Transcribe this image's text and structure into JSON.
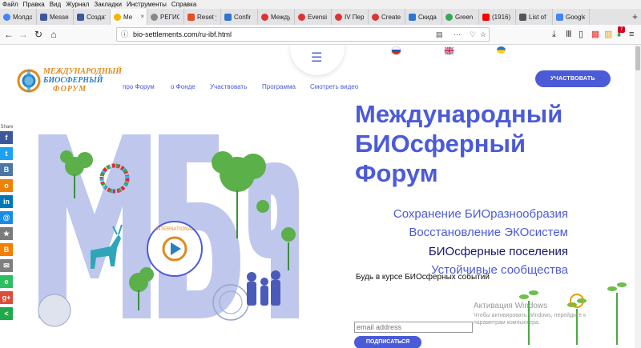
{
  "menu": [
    "Файл",
    "Правка",
    "Вид",
    "Журнал",
    "Закладки",
    "Инструменты",
    "Справка"
  ],
  "tabs": [
    {
      "label": "Молдо",
      "color": "#4285f4",
      "round": true
    },
    {
      "label": "Messen",
      "color": "#3b5998",
      "round": false
    },
    {
      "label": "Создат",
      "color": "#3b5998",
      "round": false
    },
    {
      "label": "Ме",
      "color": "#f4b400",
      "round": true,
      "active": true
    },
    {
      "label": "РЕГИС",
      "color": "#888888",
      "round": true
    },
    {
      "label": "Reset y",
      "color": "#e34f26",
      "round": false
    },
    {
      "label": "Confir",
      "color": "#2d78cd",
      "round": false
    },
    {
      "label": "Между",
      "color": "#d33",
      "round": true
    },
    {
      "label": "Evensi",
      "color": "#d33",
      "round": true
    },
    {
      "label": "IV Пер",
      "color": "#d33",
      "round": true
    },
    {
      "label": "Create",
      "color": "#d33",
      "round": true
    },
    {
      "label": "Скида",
      "color": "#2d78cd",
      "round": false
    },
    {
      "label": "Green C",
      "color": "#34a853",
      "round": true
    },
    {
      "label": "(1916)",
      "color": "#ff0000",
      "round": false
    },
    {
      "label": "List of f",
      "color": "#555555",
      "round": false
    },
    {
      "label": "Google",
      "color": "#4285f4",
      "round": false
    }
  ],
  "address": {
    "url": "bio-settlements.com/ru-ibf.html"
  },
  "toolbar": {
    "downloads_badge": "7"
  },
  "logo": {
    "line1": "МЕЖДУНАРОДНЫЙ",
    "line2": "БИОСФЕРНЫЙ",
    "line3": "ФОРУМ"
  },
  "nav": [
    {
      "label": "про Форум"
    },
    {
      "label": "о Фонде"
    },
    {
      "label": "Участвовать"
    },
    {
      "label": "Программа"
    },
    {
      "label": "Смотреть видео"
    }
  ],
  "cta": {
    "label": "УЧАСТВОВАТЬ"
  },
  "hero": {
    "line1": "Международный",
    "line2": "БИОсферный",
    "line3": "Форум"
  },
  "taglines": [
    {
      "text": "Сохранение БИОразнообразия"
    },
    {
      "text": "Восстановление ЭКОсистем"
    },
    {
      "text": "БИОсферные поселения"
    },
    {
      "text": "Устойчивые сообщества"
    }
  ],
  "subscribe": {
    "label": "Будь в курсе БИОсферных событий",
    "placeholder": "email address",
    "button": "ПОДПИСАТЬСЯ"
  },
  "share": {
    "label": "Share",
    "buttons": [
      {
        "icon": "facebook-icon",
        "glyph": "f",
        "color": "#3b5998"
      },
      {
        "icon": "twitter-icon",
        "glyph": "t",
        "color": "#1da1f2"
      },
      {
        "icon": "vk-icon",
        "glyph": "B",
        "color": "#4a76a8"
      },
      {
        "icon": "odnoklassniki-icon",
        "glyph": "o",
        "color": "#ee8208"
      },
      {
        "icon": "linkedin-icon",
        "glyph": "in",
        "color": "#0077b5"
      },
      {
        "icon": "mail-icon",
        "glyph": "@",
        "color": "#168de2"
      },
      {
        "icon": "bookmark-icon",
        "glyph": "★",
        "color": "#7b7b7b"
      },
      {
        "icon": "blogger-icon",
        "glyph": "B",
        "color": "#f57d00"
      },
      {
        "icon": "email-icon",
        "glyph": "✉",
        "color": "#7f7f7f"
      },
      {
        "icon": "evernote-icon",
        "glyph": "e",
        "color": "#2dbe60"
      },
      {
        "icon": "google-plus-icon",
        "glyph": "g+",
        "color": "#dd4b39"
      },
      {
        "icon": "more-share-icon",
        "glyph": "<",
        "color": "#20a94a"
      }
    ]
  },
  "watermark": {
    "title": "Активация Windows",
    "line1": "Чтобы активировать Windows, перейдите к",
    "line2": "параметрам компьютера."
  },
  "emblem": {
    "text": "INTERNATIONAL"
  }
}
